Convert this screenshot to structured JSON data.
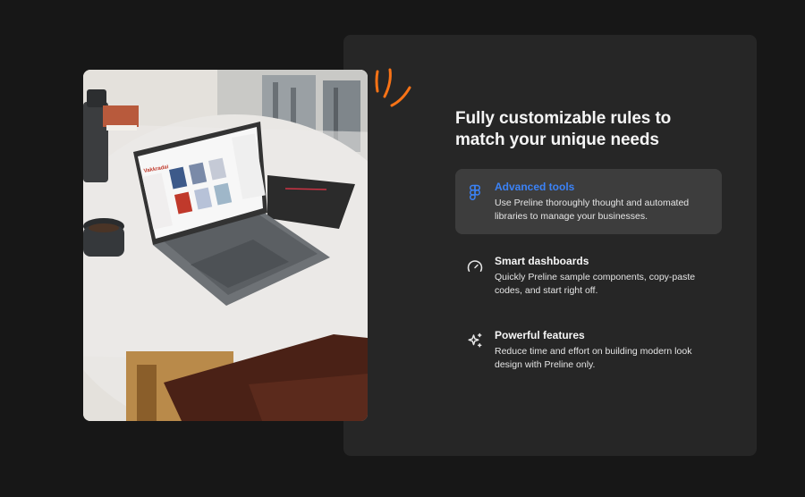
{
  "heading": "Fully customizable rules to match your unique needs",
  "features": [
    {
      "icon": "figma-icon",
      "title": "Advanced tools",
      "description": "Use Preline thoroughly thought and automated libraries to manage your businesses.",
      "active": true
    },
    {
      "icon": "gauge-icon",
      "title": "Smart dashboards",
      "description": "Quickly Preline sample components, copy-paste codes, and start right off.",
      "active": false
    },
    {
      "icon": "sparkles-icon",
      "title": "Powerful features",
      "description": "Reduce time and effort on building modern look design with Preline only.",
      "active": false
    }
  ],
  "colors": {
    "accent": "#3b82f6",
    "orange": "#f97316",
    "panel": "#262626",
    "background": "#171717"
  },
  "photo": {
    "screen_brand": "Vakkradai"
  }
}
